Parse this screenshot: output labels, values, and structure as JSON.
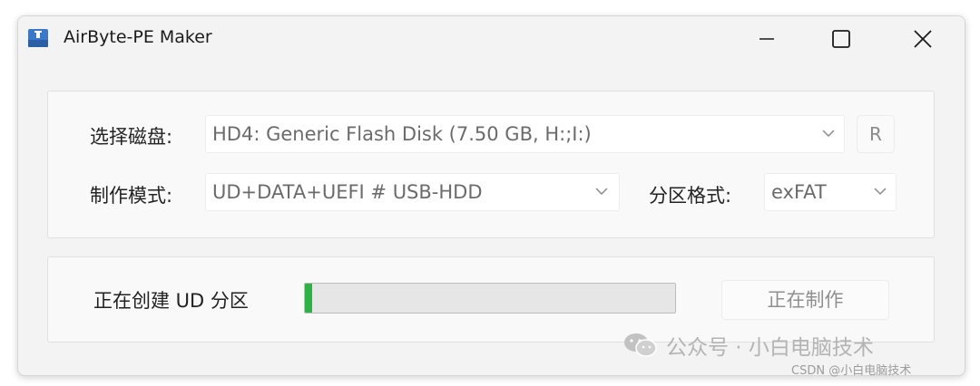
{
  "window": {
    "title": "AirByte-PE Maker"
  },
  "disk": {
    "label": "选择磁盘:",
    "selected": "HD4: Generic Flash Disk (7.50 GB, H:;I:)",
    "refresh_label": "R"
  },
  "mode": {
    "label": "制作模式:",
    "selected": "UD+DATA+UEFI # USB-HDD"
  },
  "format": {
    "label": "分区格式:",
    "selected": "exFAT"
  },
  "progress": {
    "status_text": "正在创建 UD 分区",
    "value_percent": 2,
    "color": "#2eb246"
  },
  "action": {
    "button_label": "正在制作"
  },
  "watermark": {
    "channel": "公众号 · 小白电脑技术",
    "credit": "CSDN @小白电脑技术"
  },
  "colors": {
    "window_bg": "#f3f3f3",
    "group_bg": "#f9f9f9",
    "disabled_text": "#8f8f8f"
  }
}
